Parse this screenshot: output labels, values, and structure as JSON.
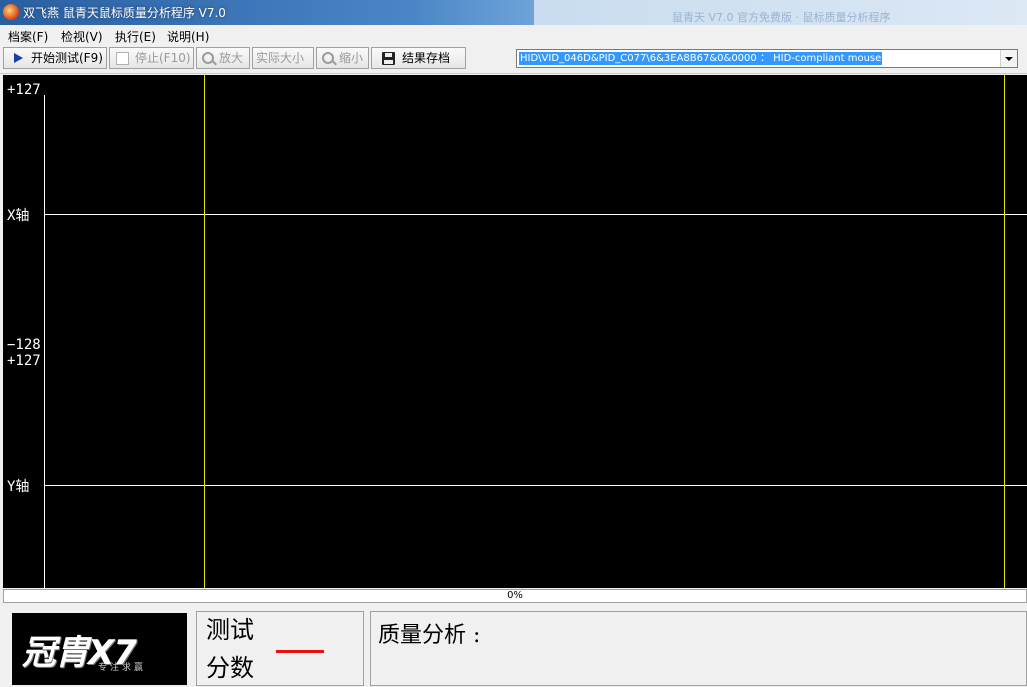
{
  "window": {
    "title": "双飞燕 鼠青天鼠标质量分析程序 V7.0",
    "background_hint": "鼠青天 V7.0 官方免费版 · 鼠标质量分析程序"
  },
  "menu": {
    "items": [
      "档案(F)",
      "检视(V)",
      "执行(E)",
      "说明(H)"
    ]
  },
  "toolbar": {
    "start_label": "开始测试(F9)",
    "stop_label": "停止(F10)",
    "zoom_in_label": "放大",
    "actual_size_label": "实际大小",
    "zoom_out_label": "缩小",
    "save_label": "结果存档"
  },
  "device": {
    "selected": "HID\\VID_046D&PID_C077\\6&3EA8B67&0&0000 ： HID-compliant mouse"
  },
  "chart": {
    "x_top": "+127",
    "x_axis": "X轴",
    "x_bottom": "−128",
    "y_top": "+127",
    "y_axis": "Y轴"
  },
  "chart_data": {
    "type": "line",
    "series": [],
    "panels": [
      {
        "axis": "X轴",
        "ylim": [
          -128,
          127
        ]
      },
      {
        "axis": "Y轴",
        "ylim": [
          -128,
          127
        ]
      }
    ]
  },
  "progress": {
    "value": 0,
    "label": "0%"
  },
  "logo": {
    "brand": "冠胄X7",
    "slogan": "专注求赢"
  },
  "score": {
    "label_line1": "测试",
    "label_line2": "分数"
  },
  "quality": {
    "label": "质量分析 :"
  },
  "colors": {
    "chart_bg": "#000000",
    "axis_white": "#ffffff",
    "marker_yellow": "#e8e800",
    "score_red": "#e81010",
    "selection_blue": "#3399ff"
  }
}
